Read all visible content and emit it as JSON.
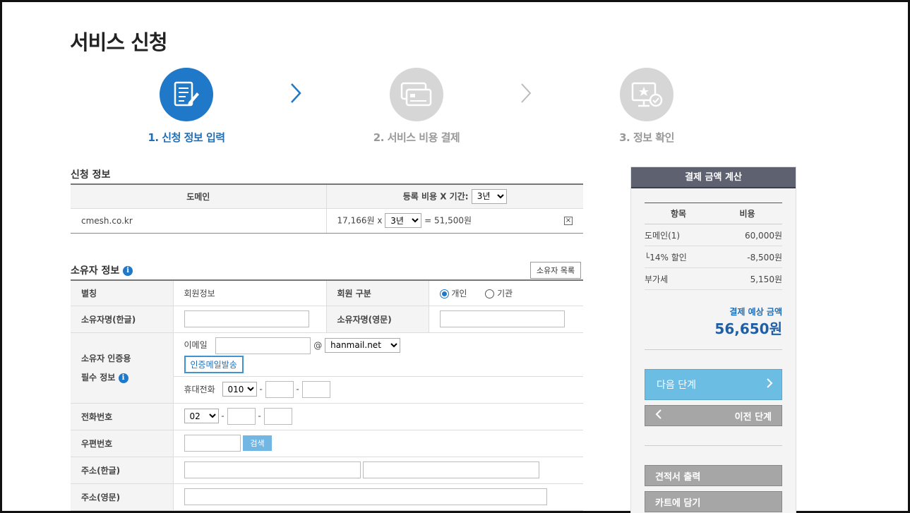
{
  "page": {
    "title": "서비스 신청"
  },
  "steps": [
    {
      "label": "1. 신청 정보 입력"
    },
    {
      "label": "2. 서비스 비용 결제"
    },
    {
      "label": "3. 정보 확인"
    }
  ],
  "apply": {
    "title": "신청 정보",
    "col_domain": "도메인",
    "col_fee": "등록 비용 X 기간:",
    "period_header": "3년",
    "domain": "cmesh.co.kr",
    "fee_unit": "17,166원 x",
    "period_row": "3년",
    "fee_total": "= 51,500원",
    "remove": "×"
  },
  "owner": {
    "title": "소유자 정보",
    "list_button": "소유자 목록",
    "alias_label": "별칭",
    "alias_value": "회원정보",
    "member_type_label": "회원 구분",
    "type_personal": "개인",
    "type_org": "기관",
    "name_kr_label": "소유자명(한글)",
    "name_en_label": "소유자명(영문)",
    "auth_label_1": "소유자 인증용",
    "auth_label_2": "필수 정보",
    "email_label": "이메일",
    "email_at": "@",
    "email_domain": "hanmail.net",
    "verify_button": "인증메일발송",
    "mobile_label": "휴대전화",
    "mobile_prefix": "010",
    "phone_label": "전화번호",
    "phone_prefix": "02",
    "dash": "-",
    "zip_label": "우편번호",
    "search_button": "검색",
    "addr_kr_label": "주소(한글)",
    "addr_en_label": "주소(영문)"
  },
  "summary": {
    "title": "결제 금액 계산",
    "col_item": "항목",
    "col_cost": "비용",
    "rows": [
      {
        "item": "도메인(1)",
        "cost": "60,000원"
      },
      {
        "item": "└14% 할인",
        "cost": "-8,500원"
      },
      {
        "item": "부가세",
        "cost": "5,150원"
      }
    ],
    "total_label": "결제 예상 금액",
    "total_amount": "56,650원",
    "next_button": "다음 단계",
    "prev_button": "이전 단계",
    "quote_button": "견적서 출력",
    "cart_button": "카트에 담기"
  },
  "colors": {
    "accent": "#1f78c8",
    "discount": "#c83232",
    "panel_header": "#5e6270"
  }
}
